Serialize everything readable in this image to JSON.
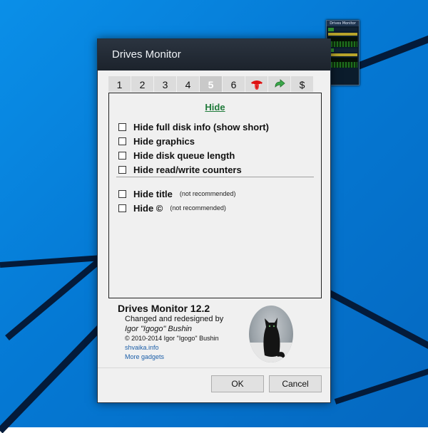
{
  "window": {
    "title": "Drives Monitor"
  },
  "gadget": {
    "title": "Drives Monitor"
  },
  "tabs": [
    {
      "label": "1"
    },
    {
      "label": "2"
    },
    {
      "label": "3"
    },
    {
      "label": "4"
    },
    {
      "label": "5",
      "active": true
    },
    {
      "label": "6"
    },
    {
      "label": "",
      "icon": "tongue-icon"
    },
    {
      "label": "",
      "icon": "green-arrow-icon"
    },
    {
      "label": "$"
    }
  ],
  "panel": {
    "heading": "Hide",
    "options": [
      {
        "label": "Hide full disk info (show short)",
        "note": ""
      },
      {
        "label": "Hide graphics",
        "note": ""
      },
      {
        "label": "Hide disk queue length",
        "note": ""
      },
      {
        "label": "Hide read/write counters",
        "note": ""
      }
    ],
    "options2": [
      {
        "label": "Hide title",
        "note": "(not recommended)"
      },
      {
        "label": "Hide ©",
        "note": "(not recommended)"
      }
    ]
  },
  "about": {
    "title": "Drives Monitor 12.2",
    "line1": "Changed and redesigned by",
    "author": "Igor \"Igogo\" Bushin",
    "copyright": "© 2010-2014 Igor \"Igogo\" Bushin",
    "site": "shvaika.info",
    "more": "More gadgets"
  },
  "buttons": {
    "ok": "OK",
    "cancel": "Cancel"
  },
  "colors": {
    "accent_green": "#1f7a3a",
    "link_blue": "#1b5ea8",
    "desktop_blue": "#0579d4"
  }
}
